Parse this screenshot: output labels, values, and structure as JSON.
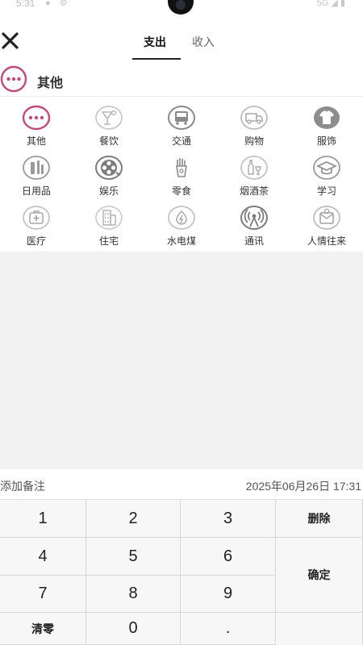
{
  "status_bar": {
    "time": "5:31",
    "network": "5G"
  },
  "tabs": [
    {
      "label": "支出",
      "active": true
    },
    {
      "label": "收入",
      "active": false
    }
  ],
  "selected": {
    "label": "其他",
    "icon": "more-dots-icon"
  },
  "accent_color": "#c2497d",
  "categories": [
    {
      "label": "其他",
      "icon": "more-dots-icon"
    },
    {
      "label": "餐饮",
      "icon": "cocktail-icon"
    },
    {
      "label": "交通",
      "icon": "bus-icon"
    },
    {
      "label": "购物",
      "icon": "delivery-truck-icon"
    },
    {
      "label": "服饰",
      "icon": "tshirt-icon"
    },
    {
      "label": "日用品",
      "icon": "toiletries-icon"
    },
    {
      "label": "娱乐",
      "icon": "film-reel-icon"
    },
    {
      "label": "零食",
      "icon": "fries-icon"
    },
    {
      "label": "烟酒茶",
      "icon": "wine-bottle-icon"
    },
    {
      "label": "学习",
      "icon": "graduation-cap-icon"
    },
    {
      "label": "医疗",
      "icon": "medical-kit-icon"
    },
    {
      "label": "住宅",
      "icon": "building-icon"
    },
    {
      "label": "水电煤",
      "icon": "utility-bolt-icon"
    },
    {
      "label": "通讯",
      "icon": "signal-tower-icon"
    },
    {
      "label": "人情往来",
      "icon": "gift-envelope-icon"
    }
  ],
  "note": {
    "placeholder": "添加备注"
  },
  "date_text": "2025年06月26日 17:31",
  "keypad": {
    "k1": "1",
    "k2": "2",
    "k3": "3",
    "k4": "4",
    "k5": "5",
    "k6": "6",
    "k7": "7",
    "k8": "8",
    "k9": "9",
    "k0": "0",
    "dot": ".",
    "delete": "删除",
    "confirm": "确定",
    "clear": "清零"
  }
}
